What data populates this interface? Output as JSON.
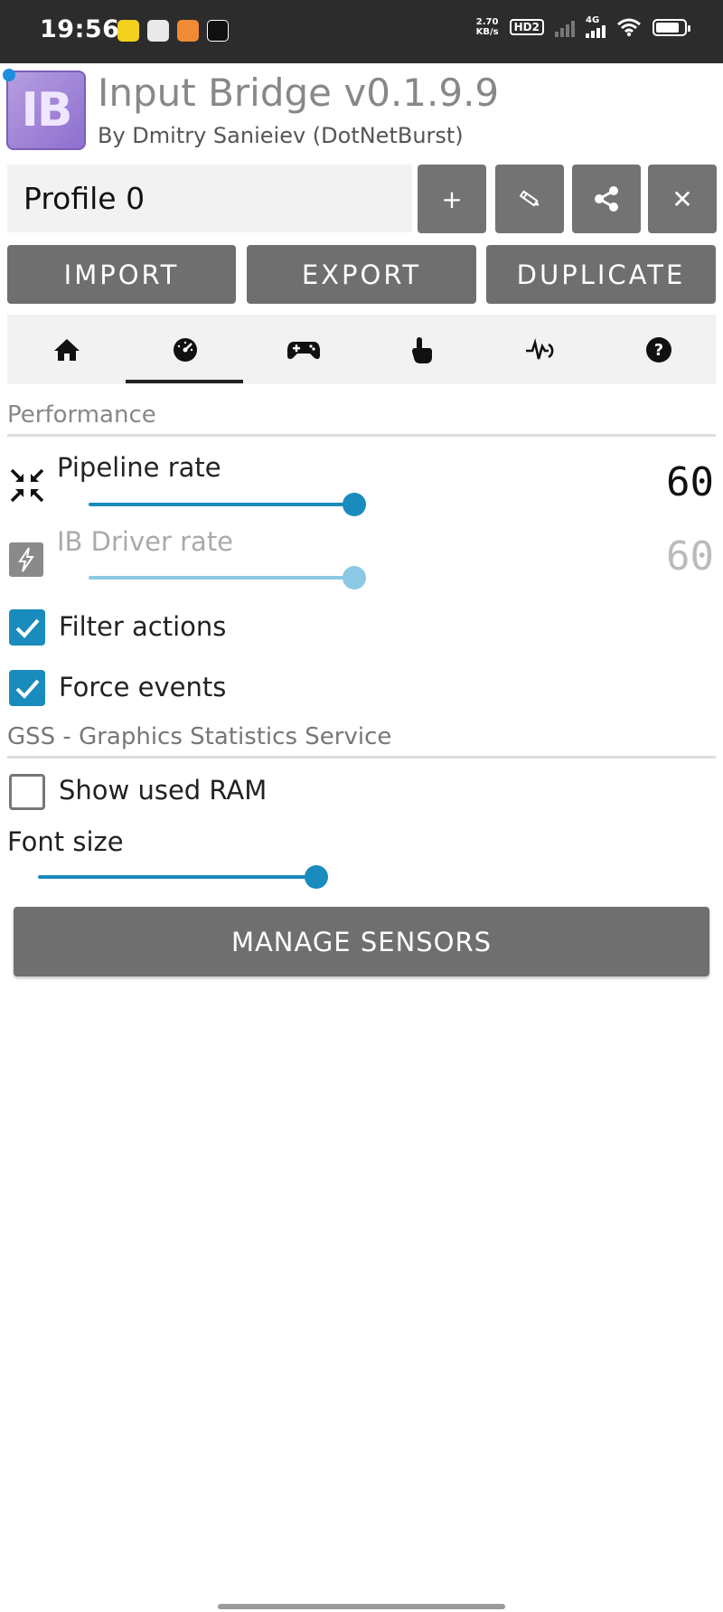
{
  "status_bar": {
    "time": "19:56",
    "net_speed_value": "2.70",
    "net_speed_unit": "KB/s",
    "hd_badge": "HD2",
    "network_label": "4G",
    "notification_icons": [
      "notes-app-icon",
      "gallery-app-icon",
      "media-app-icon",
      "tiktok-app-icon"
    ]
  },
  "app": {
    "logo_text": "IB",
    "title": "Input Bridge v0.1.9.9",
    "subtitle": "By Dmitry Sanieiev (DotNetBurst)"
  },
  "profile": {
    "name": "Profile 0",
    "buttons": {
      "add_label": "+",
      "rename_icon": "pencil-icon",
      "share_icon": "share-icon",
      "delete_label": "✕"
    }
  },
  "actions": {
    "import_label": "IMPORT",
    "export_label": "EXPORT",
    "duplicate_label": "DUPLICATE"
  },
  "tabs": {
    "items": [
      "home-icon",
      "speedometer-icon",
      "gamepad-icon",
      "touch-icon",
      "activity-icon",
      "help-icon"
    ],
    "selected_index": 1
  },
  "performance": {
    "section_title": "Performance",
    "pipeline_rate": {
      "label": "Pipeline rate",
      "value": "60",
      "fraction": 0.9,
      "icon": "compress-arrows-icon",
      "enabled": true
    },
    "ib_driver_rate": {
      "label": "IB Driver rate",
      "value": "60",
      "fraction": 0.9,
      "icon": "lightning-icon",
      "enabled": false
    },
    "filter_actions": {
      "label": "Filter actions",
      "checked": true
    },
    "force_events": {
      "label": "Force events",
      "checked": true
    }
  },
  "gss": {
    "section_title": "GSS - Graphics Statistics Service",
    "show_used_ram": {
      "label": "Show used RAM",
      "checked": false
    },
    "font_size": {
      "label": "Font size",
      "fraction": 0.9
    },
    "manage_sensors_label": "MANAGE SENSORS"
  },
  "colors": {
    "accent": "#1a8bbd",
    "button_gray": "#6f6f6f",
    "status_bar_bg": "#2c2c2c",
    "logo_purple": "#9b7fd6"
  }
}
